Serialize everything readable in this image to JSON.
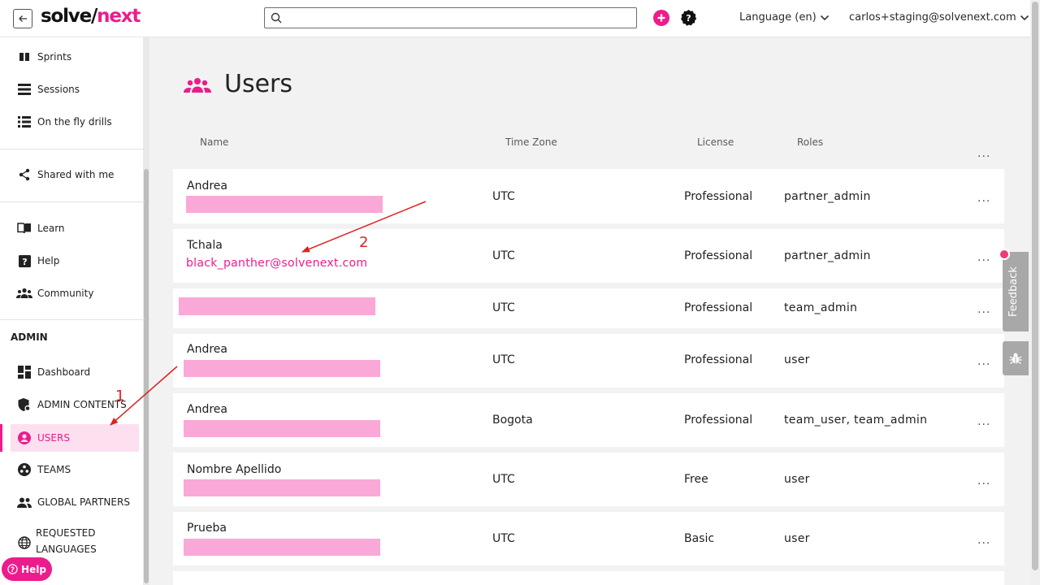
{
  "header": {
    "logo_part1": "solve/",
    "logo_part2": "next",
    "search_placeholder": "",
    "language": "Language (en)",
    "account": "carlos+staging@solvenext.com"
  },
  "sidebar": {
    "items_top": [
      {
        "label": "Sprints",
        "icon": "sprints-icon"
      },
      {
        "label": "Sessions",
        "icon": "sessions-icon"
      },
      {
        "label": "On the fly drills",
        "icon": "drills-icon"
      }
    ],
    "shared": "Shared with me",
    "items_mid": [
      {
        "label": "Learn",
        "icon": "book-icon"
      },
      {
        "label": "Help",
        "icon": "help-icon"
      },
      {
        "label": "Community",
        "icon": "community-icon"
      }
    ],
    "admin_heading": "ADMIN",
    "admin_items": [
      {
        "label": "Dashboard"
      },
      {
        "label": "ADMIN CONTENTS"
      },
      {
        "label": "USERS"
      },
      {
        "label": "TEAMS"
      },
      {
        "label": "GLOBAL PARTNERS"
      },
      {
        "label": "REQUESTED"
      },
      {
        "label": "LANGUAGES"
      }
    ],
    "help_pill": "Help"
  },
  "main": {
    "title": "Users",
    "columns": {
      "name": "Name",
      "timezone": "Time Zone",
      "license": "License",
      "roles": "Roles"
    },
    "rows": [
      {
        "name": "Andrea",
        "email": "",
        "timezone": "UTC",
        "license": "Professional",
        "roles": "partner_admin"
      },
      {
        "name": "Tchala",
        "email": "black_panther@solvenext.com",
        "timezone": "UTC",
        "license": "Professional",
        "roles": "partner_admin"
      },
      {
        "name": "",
        "email": "",
        "timezone": "UTC",
        "license": "Professional",
        "roles": "team_admin"
      },
      {
        "name": "Andrea",
        "email": "",
        "timezone": "UTC",
        "license": "Professional",
        "roles": "user"
      },
      {
        "name": "Andrea",
        "email": "",
        "timezone": "Bogota",
        "license": "Professional",
        "roles": "team_user, team_admin"
      },
      {
        "name": "Nombre Apellido",
        "email": "",
        "timezone": "UTC",
        "license": "Free",
        "roles": "user"
      },
      {
        "name": "Prueba",
        "email": "",
        "timezone": "UTC",
        "license": "Basic",
        "roles": "user"
      }
    ],
    "more": "..."
  },
  "feedback": {
    "label": "Feedback"
  },
  "annotations": {
    "one": "1",
    "two": "2"
  },
  "colors": {
    "accent": "#ec1c8c",
    "redaction": "#f9a8d8",
    "annotation": "#e02020"
  }
}
